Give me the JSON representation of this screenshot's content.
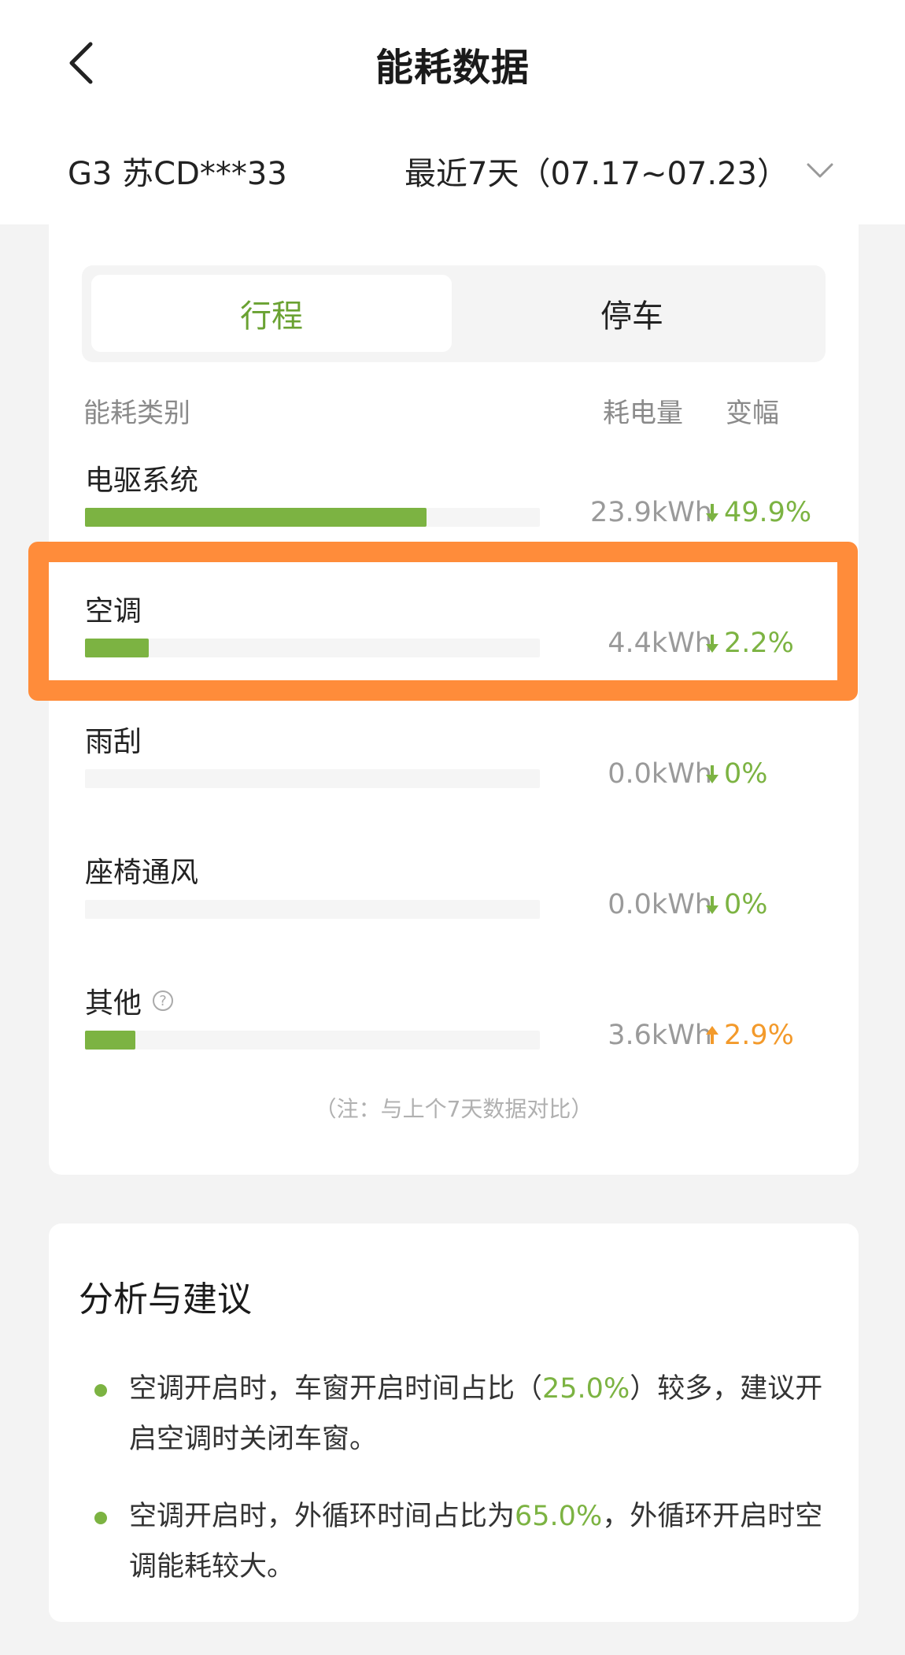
{
  "header": {
    "title": "能耗数据",
    "vehicle": "G3 苏CD***33",
    "range": "最近7天（07.17~07.23）"
  },
  "tabs": [
    {
      "label": "行程",
      "active": true
    },
    {
      "label": "停车",
      "active": false
    }
  ],
  "table_header": {
    "category": "能耗类别",
    "consumption": "耗电量",
    "change": "变幅"
  },
  "rows": [
    {
      "name": "电驱系统",
      "kwh": "23.9kWh",
      "change": "49.9%",
      "direction": "down",
      "fill_fraction": 0.75
    },
    {
      "name": "空调",
      "kwh": "4.4kWh",
      "change": "2.2%",
      "direction": "down",
      "fill_fraction": 0.14
    },
    {
      "name": "雨刮",
      "kwh": "0.0kWh",
      "change": "0%",
      "direction": "down",
      "fill_fraction": 0.0
    },
    {
      "name": "座椅通风",
      "kwh": "0.0kWh",
      "change": "0%",
      "direction": "down",
      "fill_fraction": 0.0
    },
    {
      "name": "其他",
      "kwh": "3.6kWh",
      "change": "2.9%",
      "direction": "up",
      "fill_fraction": 0.11
    }
  ],
  "note": "（注：与上个7天数据对比）",
  "analysis": {
    "title": "分析与建议",
    "tips": [
      {
        "before": "空调开启时，车窗开启时间占比（",
        "highlight": "25.0%",
        "after": "）较多，建议开启空调时关闭车窗。"
      },
      {
        "before": "空调开启时，外循环时间占比为",
        "highlight": "65.0%",
        "after": "，外循环开启时空调能耗较大。"
      }
    ]
  },
  "colors": {
    "accent_green": "#7cb342",
    "up_orange": "#f39a2b",
    "highlight_box": "#ff8c3a"
  }
}
